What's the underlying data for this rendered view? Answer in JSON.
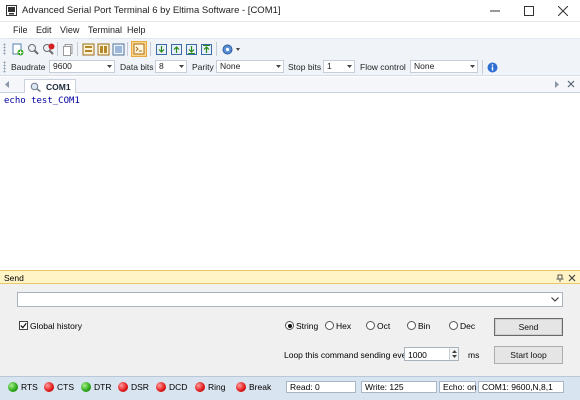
{
  "window": {
    "title": "Advanced Serial Port Terminal 6 by Eltima Software - [COM1]"
  },
  "menu": [
    "File",
    "Edit",
    "View",
    "Terminal",
    "Help"
  ],
  "settings": {
    "baudrate_label": "Baudrate",
    "baudrate_value": "9600",
    "databits_label": "Data bits",
    "databits_value": "8",
    "parity_label": "Parity",
    "parity_value": "None",
    "stopbits_label": "Stop bits",
    "stopbits_value": "1",
    "flowcontrol_label": "Flow control",
    "flowcontrol_value": "None"
  },
  "tab": {
    "label": "COM1"
  },
  "terminal": {
    "text": "echo test_COM1"
  },
  "send_panel": {
    "title": "Send",
    "input_value": "",
    "global_history_label": "Global history",
    "global_history_checked": true,
    "formats": [
      "String",
      "Hex",
      "Oct",
      "Bin",
      "Dec"
    ],
    "selected_format": "String",
    "send_button": "Send",
    "loop_label": "Loop this command sending every",
    "loop_value": "1000",
    "loop_unit": "ms",
    "start_loop_button": "Start loop"
  },
  "status": {
    "signals": [
      {
        "label": "RTS",
        "state": "green"
      },
      {
        "label": "CTS",
        "state": "red"
      },
      {
        "label": "DTR",
        "state": "green"
      },
      {
        "label": "DSR",
        "state": "red"
      },
      {
        "label": "DCD",
        "state": "red"
      },
      {
        "label": "Ring",
        "state": "red"
      },
      {
        "label": "Break",
        "state": "red"
      }
    ],
    "read": "Read:  0",
    "write": "Write:  125",
    "echo": "Echo: on",
    "port_info": "COM1: 9600,N,8,1"
  },
  "colors": {
    "terminal_text": "#0000a0",
    "send_header": "#fff4c6",
    "status_bar": "#d9e4f1",
    "led_on": "#27a513",
    "led_off": "#e01616"
  }
}
